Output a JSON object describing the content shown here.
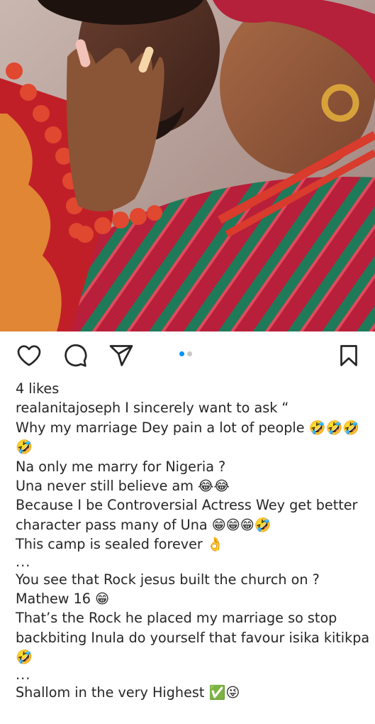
{
  "post": {
    "media": {
      "description_icon": "photo-of-couple",
      "carousel_count": 2,
      "carousel_active": 1
    },
    "actions": {
      "like_icon": "heart-icon",
      "comment_icon": "comment-icon",
      "share_icon": "paper-plane-icon",
      "save_icon": "bookmark-icon"
    },
    "likes_text": "4 likes",
    "caption": {
      "username": "realanitajoseph",
      "lines": [
        "I sincerely want to ask “",
        "Why my marriage Dey pain a lot of people 🤣🤣🤣",
        "🤣",
        "Na only me marry for Nigeria ?",
        "Una never still believe am 😂😂",
        "Because I be Controversial Actress Wey get better",
        "character pass many of Una 😁😁😁🤣",
        "This camp is sealed forever 👌",
        "...",
        "You see that Rock jesus built the church on ?",
        "Mathew 16 😁",
        "That’s the Rock he placed my marriage so stop",
        "backbiting Inula do yourself that favour isika kitikpa",
        "🤣",
        "...",
        "Shallom in the very Highest ✅😜"
      ]
    }
  },
  "colors": {
    "accent_blue": "#0095f6",
    "text": "#262626",
    "dot_inactive": "#c7c7c7"
  }
}
